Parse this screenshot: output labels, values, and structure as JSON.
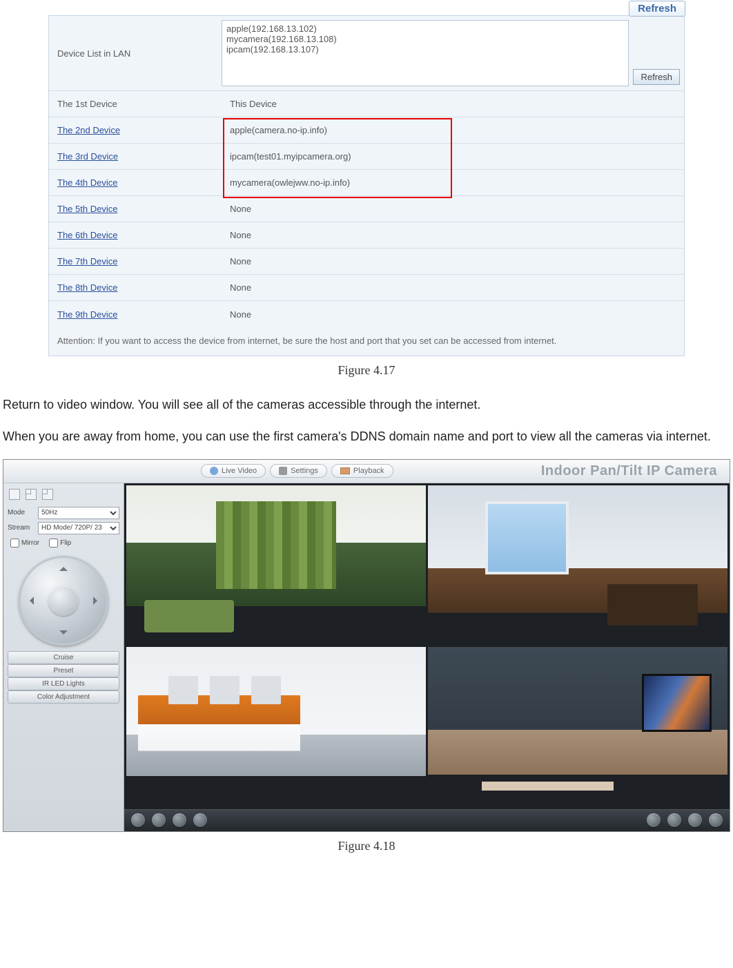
{
  "fig417": {
    "corner_refresh": "Refresh",
    "lan_label": "Device List in LAN",
    "lan_devices": "apple(192.168.13.102)\nmycamera(192.168.13.108)\nipcam(192.168.13.107)",
    "lan_refresh": "Refresh",
    "rows": [
      {
        "label": "The 1st Device",
        "link": false,
        "value": "This Device"
      },
      {
        "label": "The 2nd Device",
        "link": true,
        "value": "apple(camera.no-ip.info)"
      },
      {
        "label": "The 3rd Device",
        "link": true,
        "value": "ipcam(test01.myipcamera.org)"
      },
      {
        "label": "The 4th Device",
        "link": true,
        "value": "mycamera(owlejww.no-ip.info)"
      },
      {
        "label": "The 5th Device",
        "link": true,
        "value": "None"
      },
      {
        "label": "The 6th Device",
        "link": true,
        "value": "None"
      },
      {
        "label": "The 7th Device",
        "link": true,
        "value": "None"
      },
      {
        "label": "The 8th Device",
        "link": true,
        "value": "None"
      },
      {
        "label": "The 9th Device",
        "link": true,
        "value": "None"
      }
    ],
    "attention": "Attention: If you want to access the device from internet, be sure the host and port that you set can be accessed from internet.",
    "caption": "Figure 4.17"
  },
  "body": {
    "p1": "Return to video window. You will see all of the cameras accessible through the internet.",
    "p2": "When you are away from home, you can use the first camera's DDNS domain name and port to view all the cameras via internet."
  },
  "fig418": {
    "nav": {
      "live": "Live Video",
      "settings": "Settings",
      "playback": "Playback"
    },
    "title": "Indoor Pan/Tilt IP Camera",
    "side": {
      "mode_label": "Mode",
      "mode_value": "50Hz",
      "stream_label": "Stream",
      "stream_value": "HD Mode/ 720P/ 23",
      "mirror": "Mirror",
      "flip": "Flip",
      "buttons": [
        "Cruise",
        "Preset",
        "IR LED Lights",
        "Color Adjustment"
      ]
    },
    "caption": "Figure 4.18"
  }
}
